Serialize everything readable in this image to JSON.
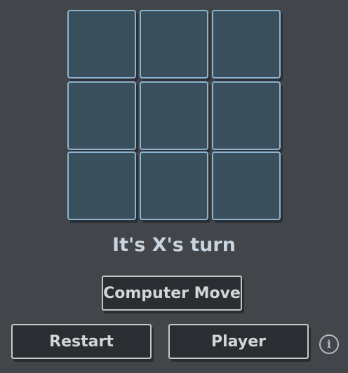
{
  "board": {
    "cells": [
      "",
      "",
      "",
      "",
      "",
      "",
      "",
      "",
      ""
    ]
  },
  "status": {
    "text": "It's X's turn"
  },
  "buttons": {
    "computer_move": "Computer Move",
    "restart": "Restart",
    "player": "Player"
  },
  "info": {
    "glyph": "i"
  },
  "colors": {
    "background": "#424549",
    "cell_fill": "#3a4f5c",
    "cell_border": "#8cb4d0",
    "button_fill": "#2a2d31",
    "button_border": "#c5c8cb",
    "text": "#c9d4de"
  }
}
